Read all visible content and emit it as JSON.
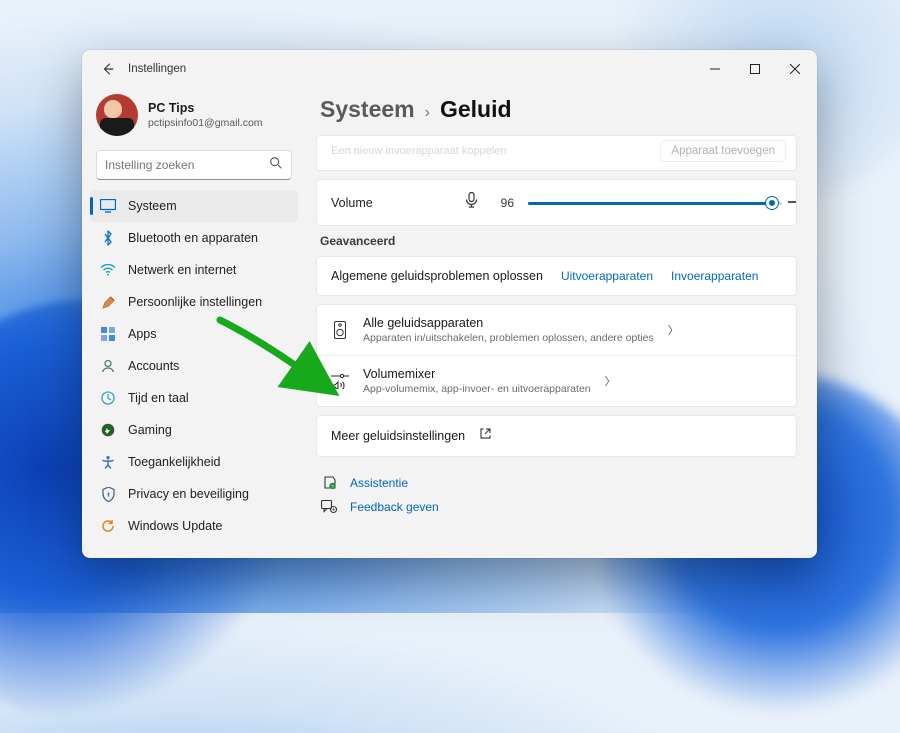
{
  "titlebar": {
    "title": "Instellingen"
  },
  "profile": {
    "name": "PC Tips",
    "email": "pctipsinfo01@gmail.com"
  },
  "search": {
    "placeholder": "Instelling zoeken"
  },
  "sidebar": {
    "items": [
      {
        "label": "Systeem",
        "icon": "system"
      },
      {
        "label": "Bluetooth en apparaten",
        "icon": "bluetooth"
      },
      {
        "label": "Netwerk en internet",
        "icon": "wifi"
      },
      {
        "label": "Persoonlijke instellingen",
        "icon": "personalize"
      },
      {
        "label": "Apps",
        "icon": "apps"
      },
      {
        "label": "Accounts",
        "icon": "accounts"
      },
      {
        "label": "Tijd en taal",
        "icon": "time"
      },
      {
        "label": "Gaming",
        "icon": "gaming"
      },
      {
        "label": "Toegankelijkheid",
        "icon": "accessibility"
      },
      {
        "label": "Privacy en beveiliging",
        "icon": "privacy"
      },
      {
        "label": "Windows Update",
        "icon": "update"
      }
    ]
  },
  "breadcrumb": {
    "parent": "Systeem",
    "current": "Geluid"
  },
  "peek": {
    "text": "Een nieuw invoerapparaat koppelen",
    "button": "Apparaat toevoegen"
  },
  "volume": {
    "label": "Volume",
    "value": "96",
    "percent": 96
  },
  "advanced": {
    "label": "Geavanceerd",
    "troubleshoot": {
      "title": "Algemene geluidsproblemen oplossen",
      "output": "Uitvoerapparaten",
      "input": "Invoerapparaten"
    },
    "allDevices": {
      "title": "Alle geluidsapparaten",
      "sub": "Apparaten in/uitschakelen, problemen oplossen, andere opties"
    },
    "mixer": {
      "title": "Volumemixer",
      "sub": "App-volumemix, app-invoer- en uitvoerapparaten"
    },
    "more": {
      "title": "Meer geluidsinstellingen"
    }
  },
  "footer": {
    "assist": "Assistentie",
    "feedback": "Feedback geven"
  }
}
